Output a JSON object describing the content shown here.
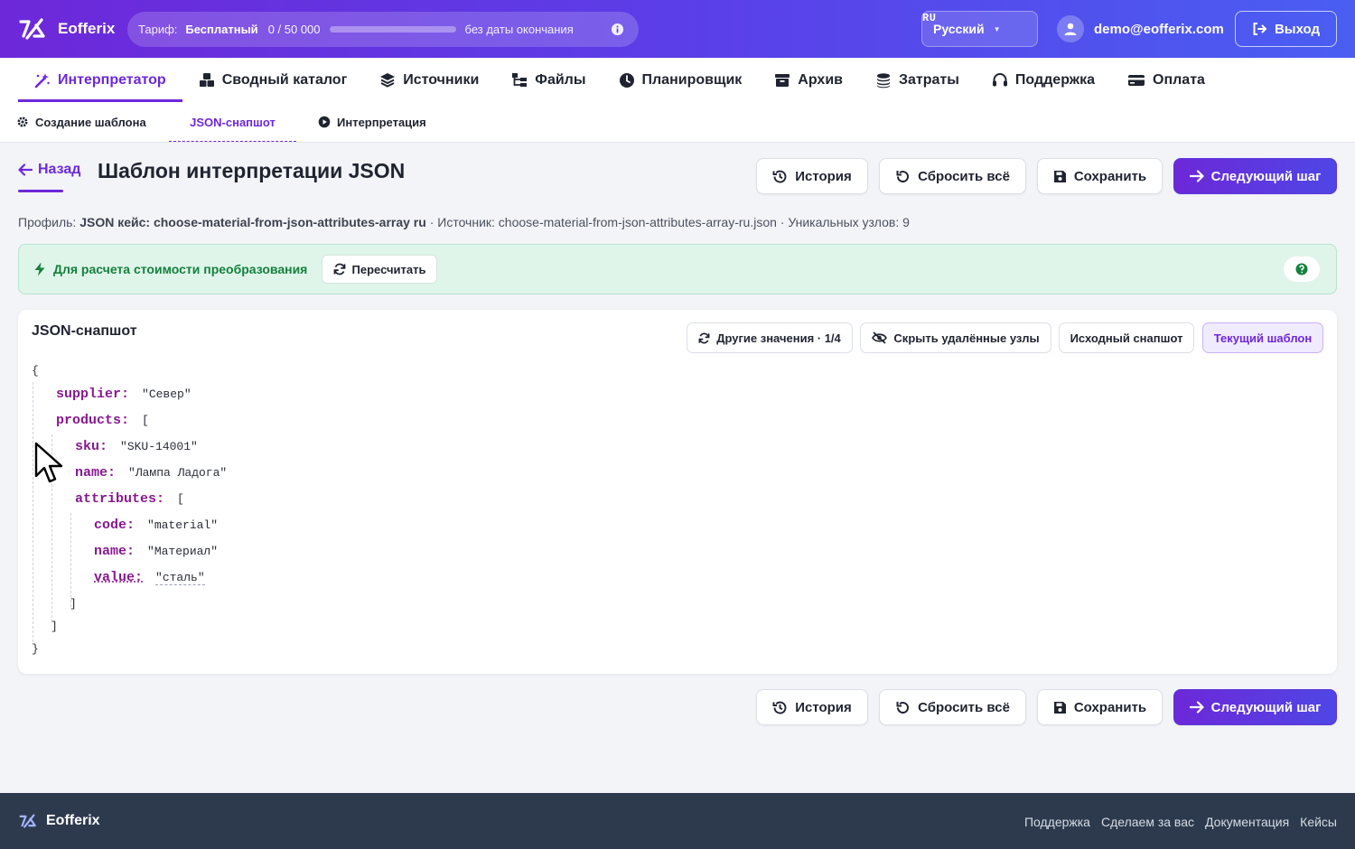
{
  "app": {
    "name": "Eofferix"
  },
  "tariff": {
    "label": "Тариф:",
    "plan": "Бесплатный",
    "usage": "0 / 50 000",
    "usage_fraction": 0,
    "no_end": "без даты окончания"
  },
  "language": {
    "code": "RU",
    "label": "Русский"
  },
  "user": {
    "email": "demo@eofferix.com"
  },
  "logout": {
    "label": "Выход"
  },
  "main_nav": [
    {
      "label": "Интерпретатор",
      "icon": "magic-wand-icon",
      "active": true
    },
    {
      "label": "Сводный каталог",
      "icon": "boxes-icon",
      "active": false
    },
    {
      "label": "Источники",
      "icon": "layers-icon",
      "active": false
    },
    {
      "label": "Файлы",
      "icon": "file-tree-icon",
      "active": false
    },
    {
      "label": "Планировщик",
      "icon": "clock-icon",
      "active": false
    },
    {
      "label": "Архив",
      "icon": "archive-icon",
      "active": false
    },
    {
      "label": "Затраты",
      "icon": "coins-icon",
      "active": false
    },
    {
      "label": "Поддержка",
      "icon": "headset-icon",
      "active": false
    },
    {
      "label": "Оплата",
      "icon": "credit-card-icon",
      "active": false
    }
  ],
  "sub_nav": [
    {
      "label": "Создание шаблона",
      "icon": "gear-icon",
      "active": false
    },
    {
      "label": "JSON-снапшот",
      "icon": "",
      "active": true
    },
    {
      "label": "Интерпретация",
      "icon": "play-circle-icon",
      "active": false
    }
  ],
  "header": {
    "back": "Назад",
    "title": "Шаблон интерпретации JSON",
    "history": "История",
    "reset": "Сбросить всё",
    "save": "Сохранить",
    "next": "Следующий шаг"
  },
  "meta": {
    "profile_label": "Профиль:",
    "profile_value": "JSON кейс: choose-material-from-json-attributes-array ru",
    "source": "· Источник: choose-material-from-json-attributes-array-ru.json · Уникальных узлов: 9"
  },
  "notice": {
    "text": "Для расчета стоимости преобразования",
    "recalc": "Пересчитать"
  },
  "snapshot": {
    "title": "JSON-снапшот",
    "other_values": "Другие значения · 1/4",
    "hide_removed": "Скрыть удалённые узлы",
    "original": "Исходный снапшот",
    "current": "Текущий шаблон",
    "json": {
      "open": "{",
      "close": "}",
      "supplier_key": "supplier:",
      "supplier_val": "\"Север\"",
      "products_key": "products:",
      "products_open": "[",
      "products_close": "]",
      "sku_key": "sku:",
      "sku_val": "\"SKU-14001\"",
      "name_key": "name:",
      "name_val": "\"Лампа Ладога\"",
      "attributes_key": "attributes:",
      "attributes_open": "[",
      "attributes_close": "]",
      "code_key": "code:",
      "code_val": "\"material\"",
      "attr_name_key": "name:",
      "attr_name_val": "\"Материал\"",
      "value_key": "value:",
      "value_val": "\"сталь\""
    }
  },
  "footer": {
    "brand": "Eofferix",
    "links": [
      "Поддержка",
      "Сделаем за вас",
      "Документация",
      "Кейсы"
    ]
  },
  "colors": {
    "accent": "#6d28d9",
    "success": "#15803d",
    "json_key": "#86198f",
    "footer_bg": "#2d3a4e"
  }
}
